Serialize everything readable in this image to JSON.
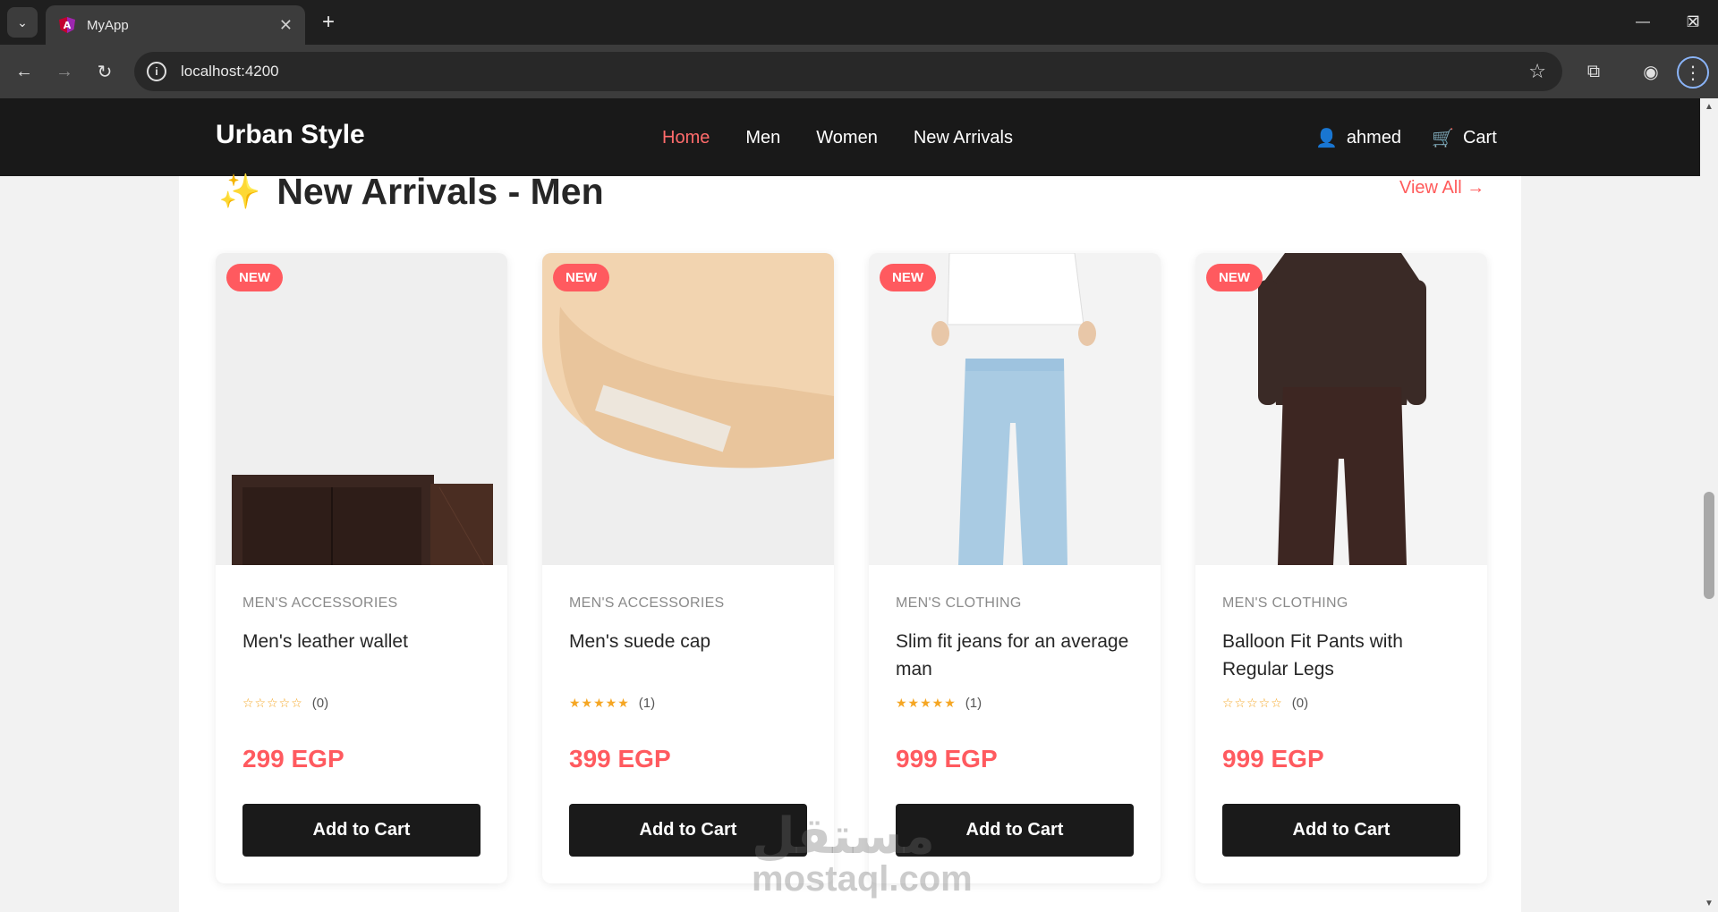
{
  "browser": {
    "tab_title": "MyApp",
    "url": "localhost:4200"
  },
  "header": {
    "brand": "Urban Style",
    "nav": [
      "Home",
      "Men",
      "Women",
      "New Arrivals"
    ],
    "active_nav": "Home",
    "user_name": "ahmed",
    "cart_label": "Cart"
  },
  "section": {
    "title": "New Arrivals - Men",
    "view_all": "View All →"
  },
  "products": [
    {
      "badge": "NEW",
      "category": "MEN'S ACCESSORIES",
      "name": "Men's leather wallet",
      "stars": "☆☆☆☆☆",
      "reviews": "(0)",
      "price": "299 EGP",
      "button": "Add to Cart"
    },
    {
      "badge": "NEW",
      "category": "MEN'S ACCESSORIES",
      "name": "Men's suede cap",
      "stars": "★★★★★",
      "reviews": "(1)",
      "price": "399 EGP",
      "button": "Add to Cart"
    },
    {
      "badge": "NEW",
      "category": "MEN'S CLOTHING",
      "name": "Slim fit jeans for an average man",
      "stars": "★★★★★",
      "reviews": "(1)",
      "price": "999 EGP",
      "button": "Add to Cart"
    },
    {
      "badge": "NEW",
      "category": "MEN'S CLOTHING",
      "name": "Balloon Fit Pants with Regular Legs",
      "stars": "☆☆☆☆☆",
      "reviews": "(0)",
      "price": "999 EGP",
      "button": "Add to Cart"
    }
  ],
  "watermark": {
    "arabic": "مستقل",
    "latin": "mostaql.com"
  },
  "colors": {
    "accent": "#ff5a5f",
    "header_bg": "#191919",
    "button_bg": "#1a1a1a",
    "star": "#f5a623"
  }
}
